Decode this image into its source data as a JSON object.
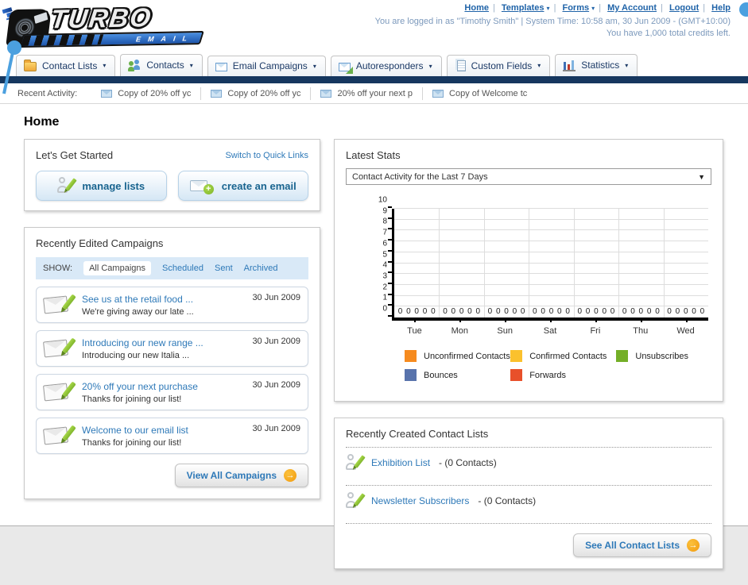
{
  "header": {
    "logo_line1": "TURBO",
    "logo_line2": "EMAIL",
    "nav_links": [
      {
        "label": "Home",
        "dropdown": false
      },
      {
        "label": "Templates",
        "dropdown": true
      },
      {
        "label": "Forms",
        "dropdown": true
      },
      {
        "label": "My Account",
        "dropdown": false
      },
      {
        "label": "Logout",
        "dropdown": false
      },
      {
        "label": "Help",
        "dropdown": false
      }
    ],
    "login_info": "You are logged in as \"Timothy Smith\" | System Time: 10:58 am, 30 Jun 2009 - (GMT+10:00)",
    "credits_info": "You have 1,000 total credits left."
  },
  "tabs": [
    {
      "label": "Contact Lists"
    },
    {
      "label": "Contacts"
    },
    {
      "label": "Email Campaigns"
    },
    {
      "label": "Autoresponders"
    },
    {
      "label": "Custom Fields"
    },
    {
      "label": "Statistics"
    }
  ],
  "recent_activity": {
    "label": "Recent Activity:",
    "items": [
      {
        "text": "Copy of 20% off yc"
      },
      {
        "text": "Copy of 20% off yc"
      },
      {
        "text": "20% off your next p"
      },
      {
        "text": "Copy of Welcome tc"
      }
    ]
  },
  "page_title": "Home",
  "get_started": {
    "title": "Let's Get Started",
    "switch_link": "Switch to Quick Links",
    "manage_lists_label": "manage lists",
    "create_email_label": "create an email"
  },
  "campaigns": {
    "title": "Recently Edited Campaigns",
    "show_label": "SHOW:",
    "filters": [
      {
        "label": "All Campaigns",
        "active": true
      },
      {
        "label": "Scheduled",
        "active": false
      },
      {
        "label": "Sent",
        "active": false
      },
      {
        "label": "Archived",
        "active": false
      }
    ],
    "items": [
      {
        "title": "See us at the retail food ...",
        "subtitle": "We're giving away our late ...",
        "date": "30 Jun 2009"
      },
      {
        "title": "Introducing our new range ...",
        "subtitle": "Introducing our new Italia ...",
        "date": "30 Jun 2009"
      },
      {
        "title": "20% off your next purchase",
        "subtitle": "Thanks for joining our list!",
        "date": "30 Jun 2009"
      },
      {
        "title": "Welcome to our email list",
        "subtitle": "Thanks for joining our list!",
        "date": "30 Jun 2009"
      }
    ],
    "view_all_label": "View All Campaigns"
  },
  "stats": {
    "title": "Latest Stats",
    "dropdown_value": "Contact Activity for the Last 7 Days"
  },
  "chart_data": {
    "type": "bar",
    "title": "Contact Activity for the Last 7 Days",
    "categories": [
      "Tue",
      "Mon",
      "Sun",
      "Sat",
      "Fri",
      "Thu",
      "Wed"
    ],
    "series": [
      {
        "name": "Unconfirmed Contacts",
        "color": "#F68B1F",
        "values": [
          0,
          0,
          0,
          0,
          0,
          0,
          0
        ]
      },
      {
        "name": "Confirmed Contacts",
        "color": "#FBC12D",
        "values": [
          0,
          0,
          0,
          0,
          0,
          0,
          0
        ]
      },
      {
        "name": "Unsubscribes",
        "color": "#74AF27",
        "values": [
          0,
          0,
          0,
          0,
          0,
          0,
          0
        ]
      },
      {
        "name": "Bounces",
        "color": "#5873AC",
        "values": [
          0,
          0,
          0,
          0,
          0,
          0,
          0
        ]
      },
      {
        "name": "Forwards",
        "color": "#E8502A",
        "values": [
          0,
          0,
          0,
          0,
          0,
          0,
          0
        ]
      }
    ],
    "xlabel": "",
    "ylabel": "",
    "ylim": [
      0,
      10
    ],
    "yticks": [
      0,
      1,
      2,
      3,
      4,
      5,
      6,
      7,
      8,
      9,
      10
    ],
    "grid": true,
    "legend_position": "bottom"
  },
  "contact_lists": {
    "title": "Recently Created Contact Lists",
    "items": [
      {
        "name": "Exhibition List",
        "suffix": " - (0 Contacts)"
      },
      {
        "name": "Newsletter Subscribers",
        "suffix": " - (0 Contacts)"
      }
    ],
    "see_all_label": "See All Contact Lists"
  },
  "colors": {
    "navy_bar": "#16375F",
    "link_blue": "#2E79B8",
    "button_text": "#19648F",
    "filter_bar_bg": "#D9E9F7",
    "orange_arrow": "#F29A0E",
    "help_bubble": "#4BA0DF"
  }
}
